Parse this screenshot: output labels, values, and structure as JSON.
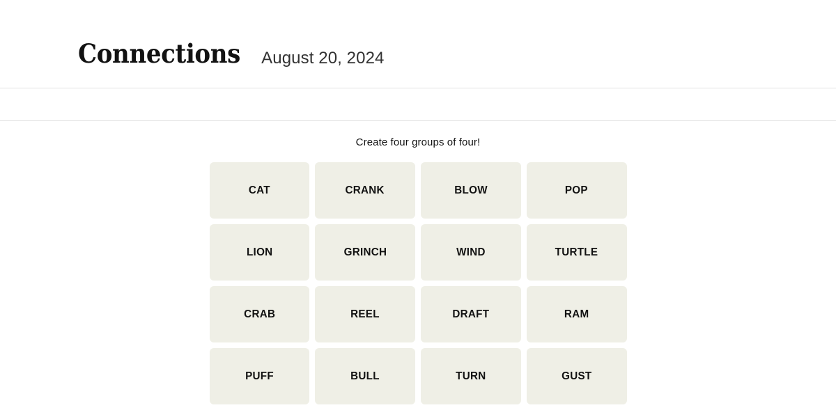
{
  "header": {
    "title": "Connections",
    "date": "August 20, 2024"
  },
  "board": {
    "instruction": "Create four groups of four!",
    "tiles": [
      "CAT",
      "CRANK",
      "BLOW",
      "POP",
      "LION",
      "GRINCH",
      "WIND",
      "TURTLE",
      "CRAB",
      "REEL",
      "DRAFT",
      "RAM",
      "PUFF",
      "BULL",
      "TURN",
      "GUST"
    ]
  },
  "colors": {
    "page_background": "#ffffff",
    "tile_background": "#efefe6",
    "text": "#121212",
    "rule": "#e2e2e2"
  }
}
